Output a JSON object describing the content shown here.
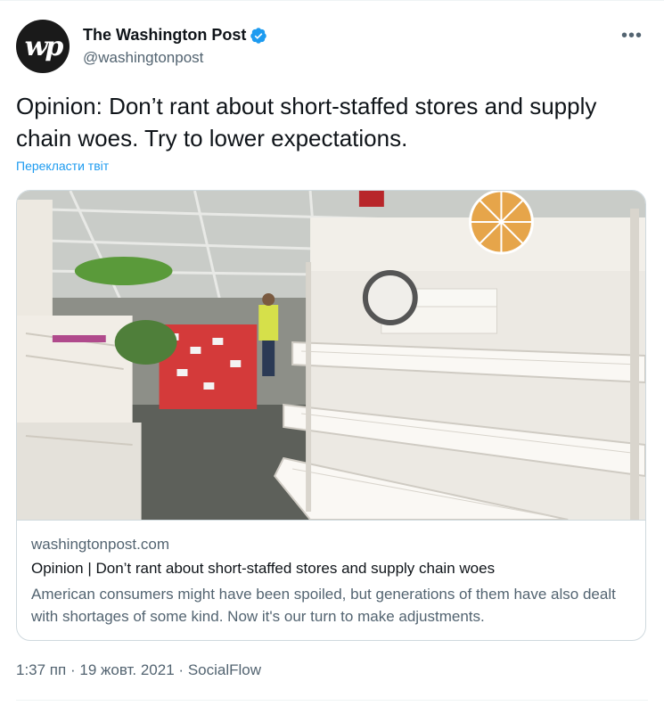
{
  "account": {
    "display_name": "The Washington Post",
    "handle": "@washingtonpost",
    "avatar_text": "wp",
    "verified_color": "#1d9bf0"
  },
  "more_label": "•••",
  "tweet": {
    "text": "Opinion: Don’t rant about short-staffed stores and supply chain woes. Try to lower expectations.",
    "translate_label": "Перекласти твіт"
  },
  "card": {
    "domain": "washingtonpost.com",
    "title": "Opinion | Don’t rant about short-staffed stores and supply chain woes",
    "description": "American consumers might have been spoiled, but generations of them have also dealt with shortages of some kind. Now it's our turn to make adjustments.",
    "image_icon": "store-empty-shelves-photo"
  },
  "meta": {
    "time": "1:37 пп",
    "separator": "·",
    "date": "19 жовт. 2021",
    "source": "SocialFlow"
  }
}
